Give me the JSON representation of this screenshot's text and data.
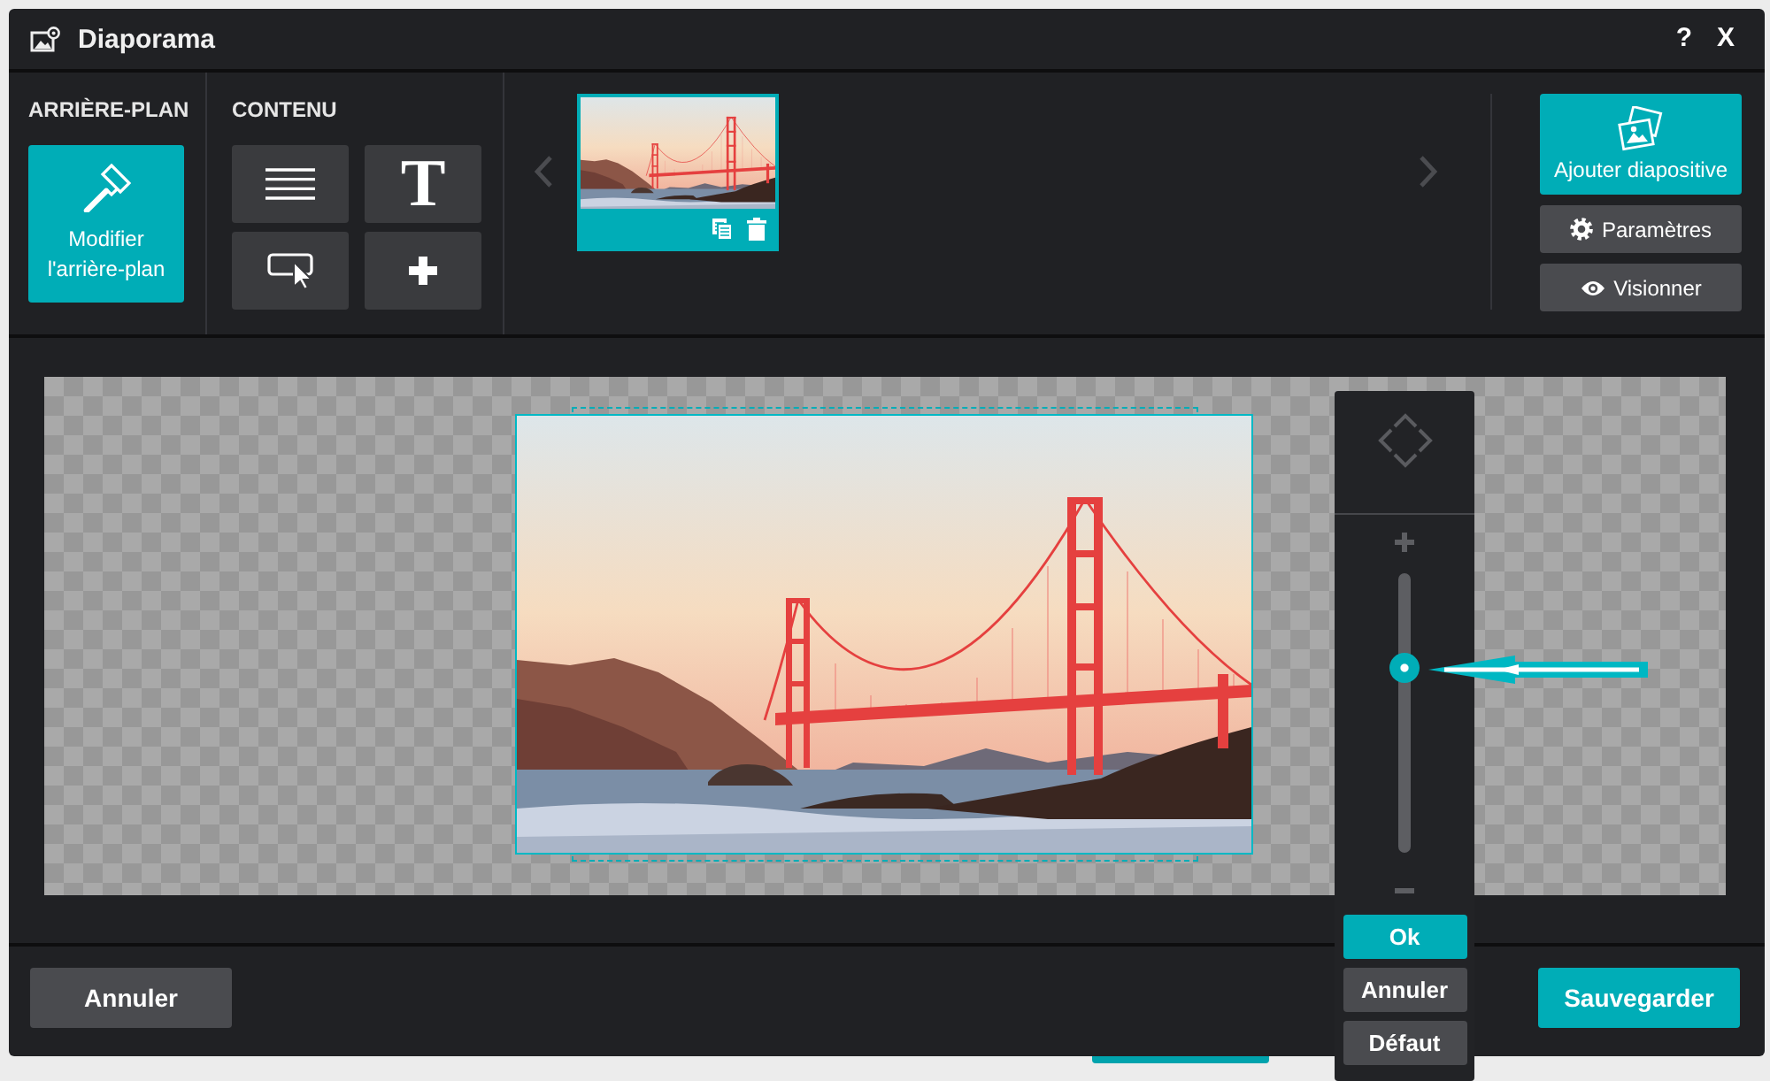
{
  "window": {
    "title": "Diaporama",
    "help": "?",
    "close": "X"
  },
  "background_section": {
    "heading": "ARRIÈRE-PLAN",
    "button": "Modifier l'arrière-plan"
  },
  "content_section": {
    "heading": "CONTENU",
    "tools": [
      {
        "kind": "lines"
      },
      {
        "kind": "text",
        "label": "T"
      },
      {
        "kind": "select"
      },
      {
        "kind": "add"
      }
    ]
  },
  "slides": [
    {
      "selected": true
    }
  ],
  "slide_actions": [
    {
      "kind": "add",
      "label": "Ajouter diapositive"
    },
    {
      "kind": "settings",
      "label": "Paramètres"
    },
    {
      "kind": "preview",
      "label": "Visionner"
    }
  ],
  "zoom": {
    "level": 0.66,
    "buttons": [
      {
        "label": "Ok",
        "primary": true
      },
      {
        "label": "Annuler",
        "primary": false
      },
      {
        "label": "Défaut",
        "primary": false
      }
    ]
  },
  "footer": {
    "buttons": [
      {
        "label": "Annuler",
        "primary": false
      },
      {
        "label": "Sauvegarder",
        "primary": true
      }
    ]
  }
}
